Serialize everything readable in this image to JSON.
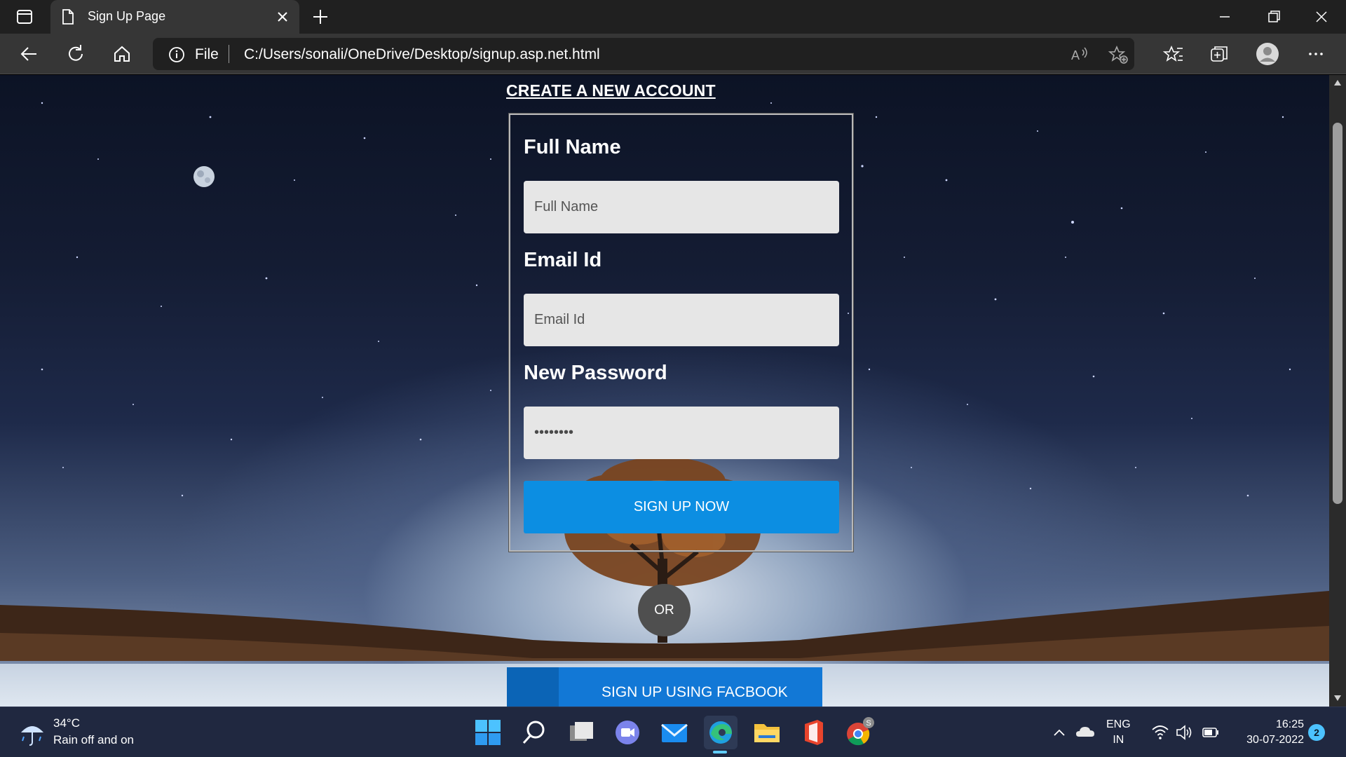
{
  "browser": {
    "tab_title": "Sign Up Page",
    "protocol_label": "File",
    "url": "C:/Users/sonali/OneDrive/Desktop/signup.asp.net.html"
  },
  "page": {
    "heading": "CREATE A NEW ACCOUNT",
    "form": {
      "fullname_label": "Full Name",
      "fullname_placeholder": "Full Name",
      "email_label": "Email Id",
      "email_placeholder": "Email Id",
      "password_label": "New Password",
      "password_value": "••••••••",
      "submit_label": "SIGN UP NOW"
    },
    "or_label": "OR",
    "facebook_label": "SIGN UP USING FACBOOK"
  },
  "taskbar": {
    "weather_temp": "34°C",
    "weather_text": "Rain off and on",
    "lang_line1": "ENG",
    "lang_line2": "IN",
    "time": "16:25",
    "date": "30-07-2022",
    "notification_count": "2",
    "chrome_badge": "S"
  },
  "colors": {
    "submit_button": "#0c8ee2",
    "facebook_button": "#1278d6",
    "or_badge": "#4f4f4f",
    "input_bg": "#e6e6e6"
  }
}
